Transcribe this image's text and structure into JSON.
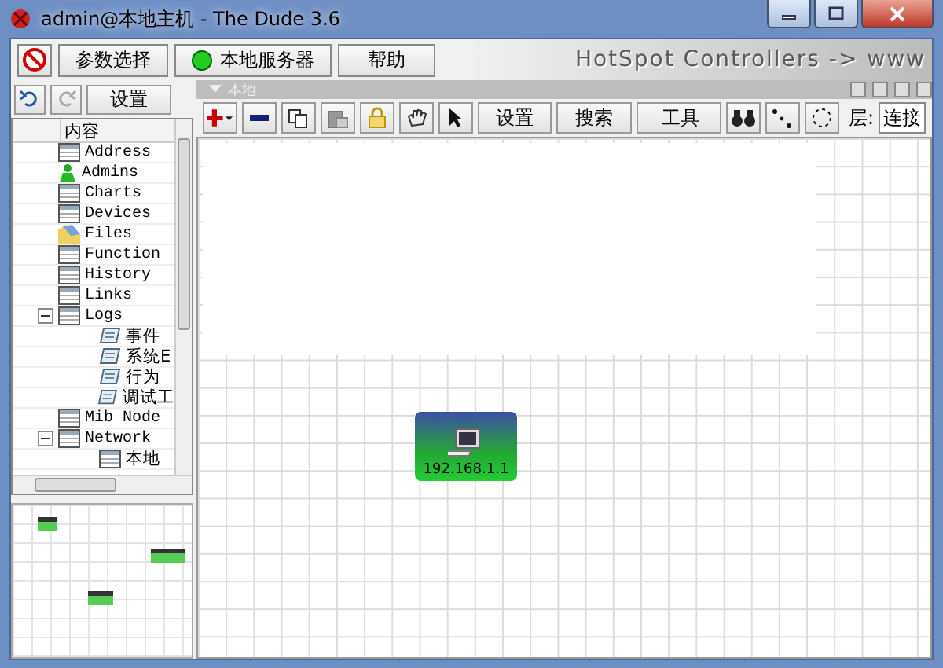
{
  "window": {
    "title": "admin@本地主机 - The Dude 3.6"
  },
  "main_toolbar": {
    "preferences": "参数选择",
    "server": {
      "label": "本地服务器",
      "connected": true
    },
    "help": "帮助",
    "banner": "HotSpot Controllers -> www"
  },
  "left_toolbar": {
    "undo_enabled": true,
    "redo_enabled": false,
    "settings": "设置"
  },
  "tree": {
    "header": "内容",
    "items": [
      {
        "label": "Address",
        "kind": "table"
      },
      {
        "label": "Admins",
        "kind": "admin"
      },
      {
        "label": "Charts",
        "kind": "table"
      },
      {
        "label": "Devices",
        "kind": "table"
      },
      {
        "label": "Files",
        "kind": "files"
      },
      {
        "label": "Function",
        "kind": "table"
      },
      {
        "label": "History",
        "kind": "table"
      },
      {
        "label": "Links",
        "kind": "table"
      },
      {
        "label": "Logs",
        "kind": "table",
        "expanded": true,
        "children": [
          {
            "label": "事件",
            "kind": "log"
          },
          {
            "label": "系统E",
            "kind": "log"
          },
          {
            "label": "行为",
            "kind": "log"
          },
          {
            "label": "调试工",
            "kind": "log"
          }
        ]
      },
      {
        "label": "Mib Node",
        "kind": "table"
      },
      {
        "label": "Network",
        "kind": "table",
        "expanded": true,
        "children": [
          {
            "label": "本地",
            "kind": "table"
          }
        ]
      }
    ]
  },
  "map_panel": {
    "title": "本地",
    "toolbar": {
      "settings": "设置",
      "search": "搜索",
      "tools": "工具",
      "layer_label": "层:",
      "layer_value": "连接"
    },
    "devices": [
      {
        "label": "192.168.1.1"
      }
    ]
  }
}
